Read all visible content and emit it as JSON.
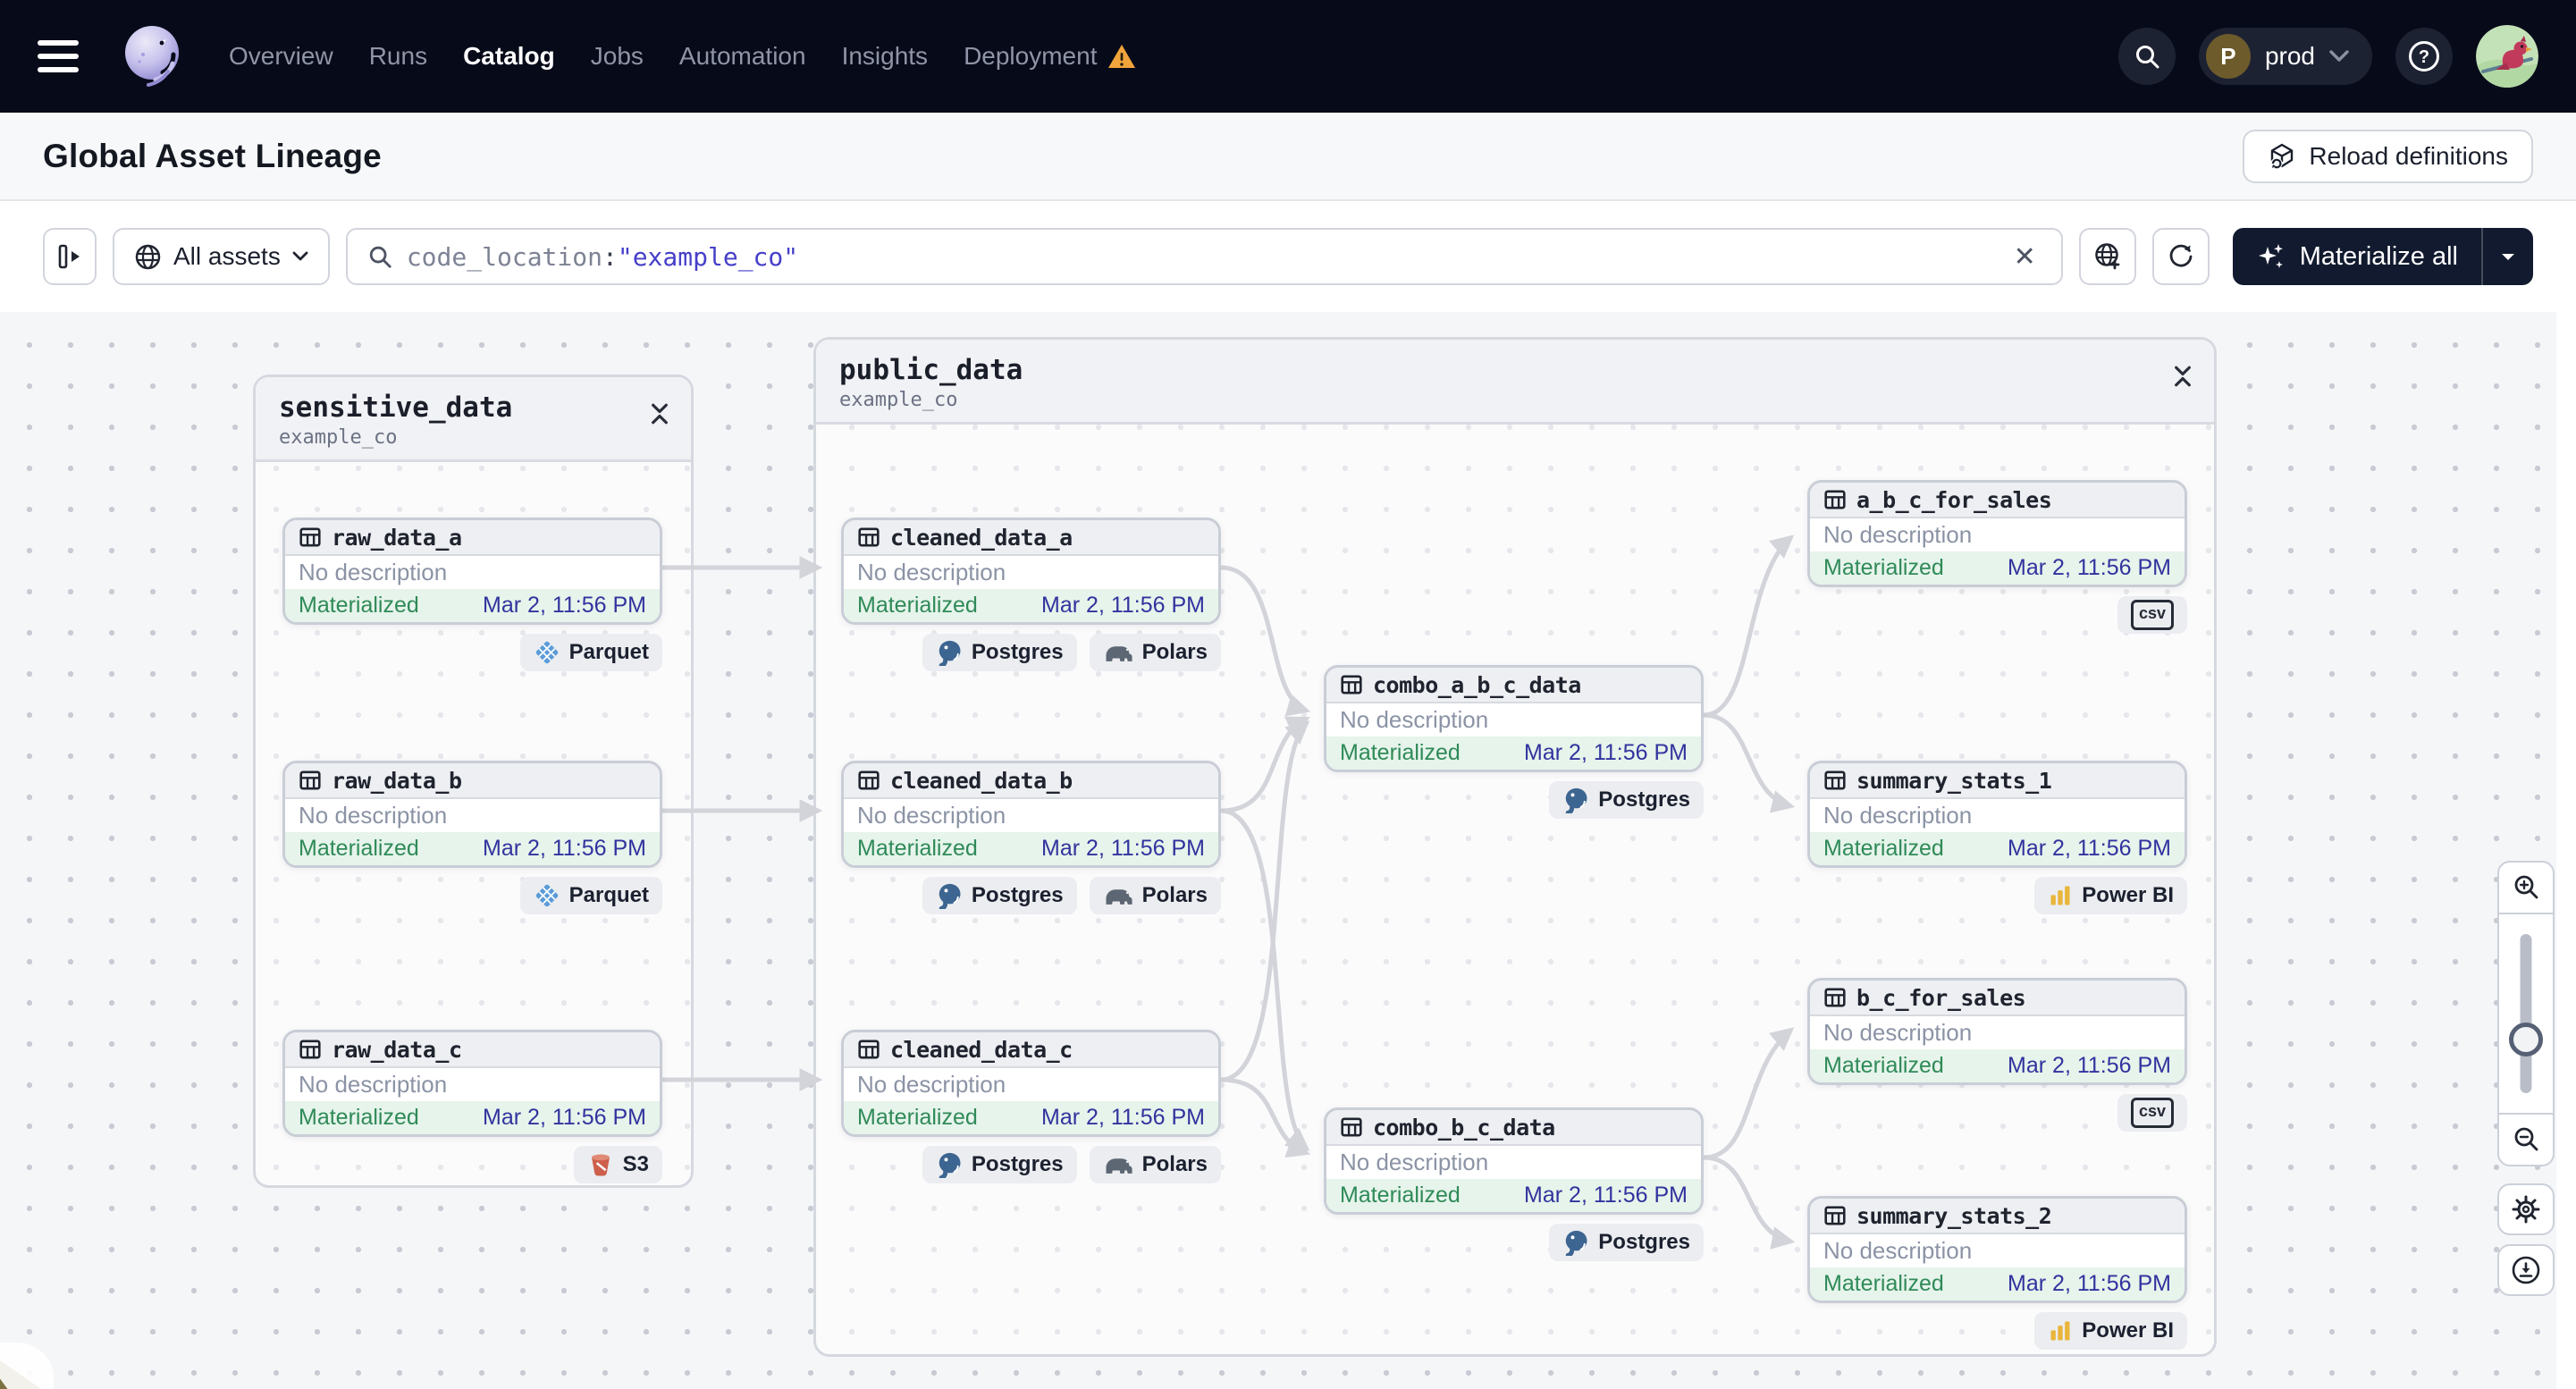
{
  "nav": {
    "items": [
      {
        "label": "Overview",
        "active": false
      },
      {
        "label": "Runs",
        "active": false
      },
      {
        "label": "Catalog",
        "active": true
      },
      {
        "label": "Jobs",
        "active": false
      },
      {
        "label": "Automation",
        "active": false
      },
      {
        "label": "Insights",
        "active": false
      },
      {
        "label": "Deployment",
        "active": false,
        "warning": true
      }
    ],
    "deployment": {
      "label": "prod",
      "initial": "P"
    }
  },
  "header": {
    "title": "Global Asset Lineage",
    "reload_button": "Reload definitions"
  },
  "toolbar": {
    "scope_label": "All assets",
    "search": {
      "field": "code_location",
      "colon": ":",
      "value": "\"example_co\""
    },
    "materialize_button": "Materialize all"
  },
  "graph": {
    "groups": [
      {
        "name": "sensitive_data",
        "location": "example_co"
      },
      {
        "name": "public_data",
        "location": "example_co"
      }
    ],
    "nodes": [
      {
        "label": "raw_data_a",
        "description": "No description",
        "status": "Materialized",
        "timestamp": "Mar 2, 11:56 PM",
        "tags": [
          {
            "label": "Parquet",
            "icon": "parquet-icon"
          }
        ]
      },
      {
        "label": "raw_data_b",
        "description": "No description",
        "status": "Materialized",
        "timestamp": "Mar 2, 11:56 PM",
        "tags": [
          {
            "label": "Parquet",
            "icon": "parquet-icon"
          }
        ]
      },
      {
        "label": "raw_data_c",
        "description": "No description",
        "status": "Materialized",
        "timestamp": "Mar 2, 11:56 PM",
        "tags": [
          {
            "label": "S3",
            "icon": "s3-icon"
          }
        ]
      },
      {
        "label": "cleaned_data_a",
        "description": "No description",
        "status": "Materialized",
        "timestamp": "Mar 2, 11:56 PM",
        "tags": [
          {
            "label": "Postgres",
            "icon": "postgres-icon"
          },
          {
            "label": "Polars",
            "icon": "polars-icon"
          }
        ]
      },
      {
        "label": "cleaned_data_b",
        "description": "No description",
        "status": "Materialized",
        "timestamp": "Mar 2, 11:56 PM",
        "tags": [
          {
            "label": "Postgres",
            "icon": "postgres-icon"
          },
          {
            "label": "Polars",
            "icon": "polars-icon"
          }
        ]
      },
      {
        "label": "cleaned_data_c",
        "description": "No description",
        "status": "Materialized",
        "timestamp": "Mar 2, 11:56 PM",
        "tags": [
          {
            "label": "Postgres",
            "icon": "postgres-icon"
          },
          {
            "label": "Polars",
            "icon": "polars-icon"
          }
        ]
      },
      {
        "label": "combo_a_b_c_data",
        "description": "No description",
        "status": "Materialized",
        "timestamp": "Mar 2, 11:56 PM",
        "tags": [
          {
            "label": "Postgres",
            "icon": "postgres-icon"
          }
        ]
      },
      {
        "label": "combo_b_c_data",
        "description": "No description",
        "status": "Materialized",
        "timestamp": "Mar 2, 11:56 PM",
        "tags": [
          {
            "label": "Postgres",
            "icon": "postgres-icon"
          }
        ]
      },
      {
        "label": "a_b_c_for_sales",
        "description": "No description",
        "status": "Materialized",
        "timestamp": "Mar 2, 11:56 PM",
        "tags": [
          {
            "label": "csv",
            "icon": "csv-icon"
          }
        ]
      },
      {
        "label": "summary_stats_1",
        "description": "No description",
        "status": "Materialized",
        "timestamp": "Mar 2, 11:56 PM",
        "tags": [
          {
            "label": "Power BI",
            "icon": "powerbi-icon"
          }
        ]
      },
      {
        "label": "b_c_for_sales",
        "description": "No description",
        "status": "Materialized",
        "timestamp": "Mar 2, 11:56 PM",
        "tags": [
          {
            "label": "csv",
            "icon": "csv-icon"
          }
        ]
      },
      {
        "label": "summary_stats_2",
        "description": "No description",
        "status": "Materialized",
        "timestamp": "Mar 2, 11:56 PM",
        "tags": [
          {
            "label": "Power BI",
            "icon": "powerbi-icon"
          }
        ]
      }
    ]
  },
  "colors": {
    "nav_background": "#070a19",
    "warning_orange": "#f2a43c",
    "materialized_green": "#2f8a58",
    "timestamp_indigo": "#32339e",
    "query_value_indigo": "#463fc9",
    "edge_gray": "#d2d4da",
    "materialize_button_bg": "#121a2f"
  }
}
